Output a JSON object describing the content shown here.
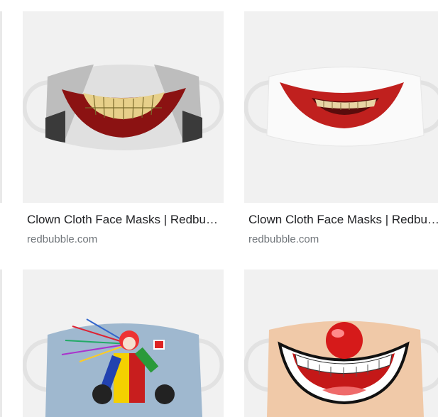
{
  "results": [
    {
      "title": "Clown Cloth Face Masks | Redbubble",
      "source": "redbubble.com",
      "image": "joker-grin-face-mask"
    },
    {
      "title": "Clown Cloth Face Masks | Redbubble",
      "source": "redbubble.com",
      "image": "red-lips-smile-face-mask"
    },
    {
      "title": "",
      "source": "",
      "image": "clown-splatter-face-mask"
    },
    {
      "title": "",
      "source": "",
      "image": "clown-nose-smile-face-mask"
    }
  ]
}
